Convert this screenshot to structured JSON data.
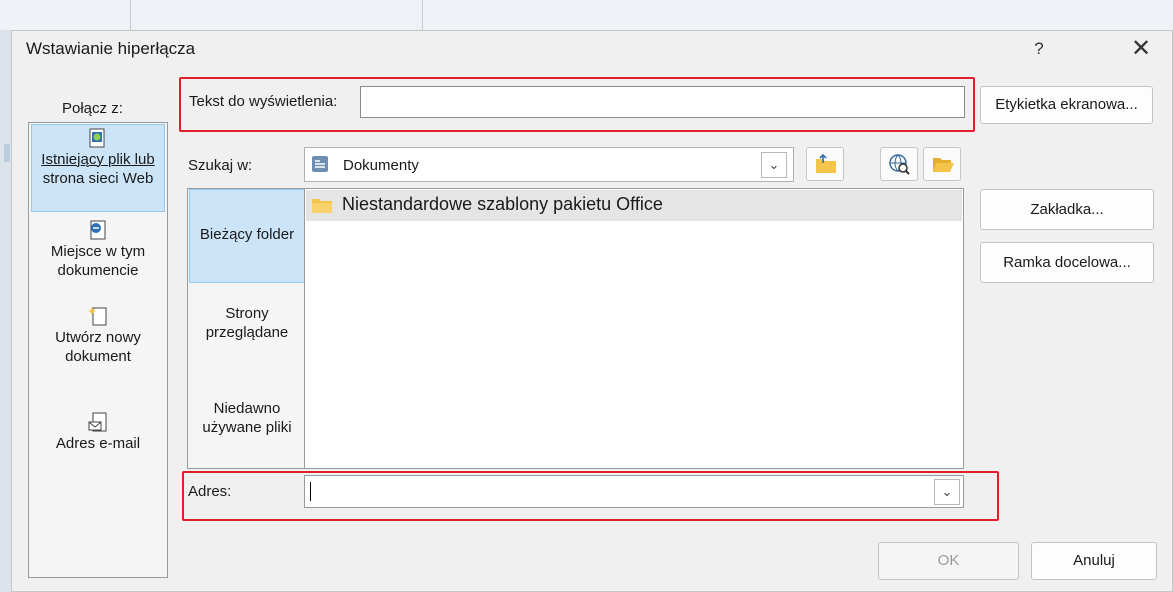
{
  "dialog": {
    "title": "Wstawianie hiperłącza",
    "help": "?",
    "close": "✕"
  },
  "link_to": {
    "label": "Połącz z:",
    "items": [
      {
        "line1": "Istniejący plik lub",
        "line2": "strona sieci Web",
        "icon": "existing-file-web-icon",
        "selected": true
      },
      {
        "line1": "Miejsce w tym",
        "line2": "dokumencie",
        "icon": "place-in-document-icon",
        "selected": false
      },
      {
        "line1": "Utwórz nowy",
        "line2": "dokument",
        "icon": "create-new-document-icon",
        "selected": false
      },
      {
        "line1": "Adres e-mail",
        "line2": "",
        "icon": "email-address-icon",
        "selected": false
      }
    ]
  },
  "text_to_display": {
    "label": "Tekst do wyświetlenia:",
    "value": ""
  },
  "screentip_button": "Etykietka ekranowa...",
  "look_in": {
    "label": "Szukaj w:",
    "value": "Dokumenty"
  },
  "browse_tabs": [
    {
      "line1": "Bieżący folder",
      "line2": "",
      "selected": true
    },
    {
      "line1": "Strony",
      "line2": "przeglądane",
      "selected": false
    },
    {
      "line1": "Niedawno",
      "line2": "używane pliki",
      "selected": false
    }
  ],
  "files": [
    "Niestandardowe szablony pakietu Office"
  ],
  "bookmark_button": "Zakładka...",
  "target_frame_button": "Ramka docelowa...",
  "address": {
    "label": "Adres:",
    "value": ""
  },
  "ok_button": "OK",
  "cancel_button": "Anuluj",
  "colors": {
    "highlight": "#e01f2a",
    "selected": "#cce4f7",
    "folder": "#f4c34a"
  }
}
